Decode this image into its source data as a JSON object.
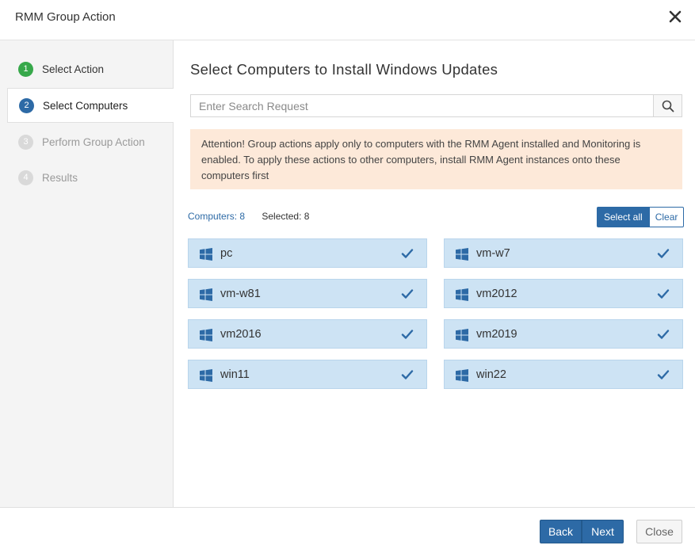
{
  "dialog": {
    "title": "RMM Group Action"
  },
  "steps": [
    {
      "number": "1",
      "label": "Select Action",
      "state": "done"
    },
    {
      "number": "2",
      "label": "Select Computers",
      "state": "active"
    },
    {
      "number": "3",
      "label": "Perform Group Action",
      "state": "pending"
    },
    {
      "number": "4",
      "label": "Results",
      "state": "pending"
    }
  ],
  "main": {
    "title": "Select Computers to Install Windows Updates",
    "search": {
      "placeholder": "Enter Search Request",
      "value": ""
    },
    "alert": "Attention! Group actions apply only to computers with the RMM Agent installed and Monitoring is enabled. To apply these actions to other computers, install RMM Agent instances onto these computers first",
    "computers_count": "Computers: 8",
    "selected_count": "Selected: 8",
    "select_all_label": "Select all",
    "clear_label": "Clear",
    "computers": [
      {
        "name": "pc",
        "selected": true
      },
      {
        "name": "vm-w7",
        "selected": true
      },
      {
        "name": "vm-w81",
        "selected": true
      },
      {
        "name": "vm2012",
        "selected": true
      },
      {
        "name": "vm2016",
        "selected": true
      },
      {
        "name": "vm2019",
        "selected": true
      },
      {
        "name": "win11",
        "selected": true
      },
      {
        "name": "win22",
        "selected": true
      }
    ]
  },
  "footer": {
    "back_label": "Back",
    "next_label": "Next",
    "close_label": "Close"
  },
  "colors": {
    "primary": "#2d6aa6",
    "done": "#37a84a",
    "tile": "#cde3f4",
    "alert_bg": "#fde9d9"
  }
}
